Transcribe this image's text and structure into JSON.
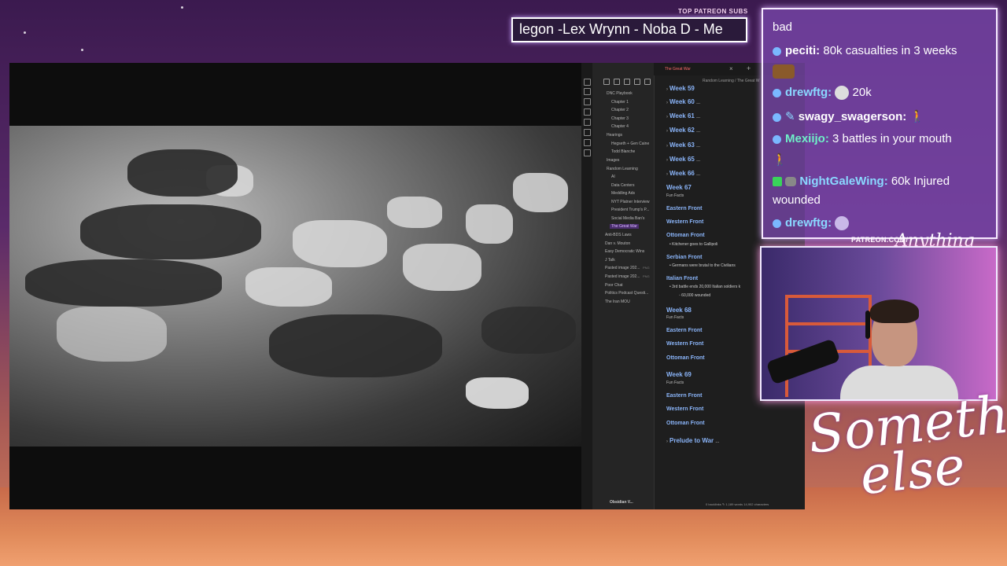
{
  "patreon": {
    "title": "TOP PATREON SUBS",
    "ticker": "legon -Lex Wrynn -  Noba D - Me"
  },
  "obsidian": {
    "tab_title": "The Great War",
    "breadcrumb": "Random Learning  /  The Great W",
    "vault_name": "Obsidian V...",
    "status": "0 backlinks   ✎  1,189 words  14,902 characters",
    "tree": [
      "DNC Playbook",
      "Chapter 1",
      "Chapter 2",
      "Chapter 3",
      "Chapter 4",
      "Hearings",
      "Hegseth + Gen Caine",
      "Todd Blanche",
      "Images",
      "Random Learning",
      "AI",
      "Data Centers",
      "Meddling Ads",
      "NYT Platner Interview",
      "President Trump's P...",
      "Social Media Ban's",
      "The Great War",
      "Anti-BDS Laws",
      "Dan v. Mouton",
      "Easy Democratic Wins",
      "J Talk",
      "Pasted image 202...",
      "Pasted image 202...",
      "Poor Chat",
      "Politics Podcast Questi...",
      "The Iran MOU"
    ],
    "tree_badges": [
      "PNG",
      "PNG"
    ],
    "outline": {
      "week59": "Week 59",
      "week60": "Week 60",
      "week61": "Week 61",
      "week62": "Week 62",
      "week63": "Week 63",
      "week65": "Week 65",
      "week66": "Week 66",
      "week67": "Week 67",
      "fun_facts_1": "Fun Facts",
      "eastern_1": "Eastern Front",
      "western_1": "Western Front",
      "ottoman_1": "Ottoman Front",
      "ottoman_note": "Kitchener goes to Gallipoli",
      "serbian": "Serbian Front",
      "serbian_note": "Germans were brutal to the Civilians",
      "italian": "Italian Front",
      "italian_note": "3rd battle ends 20,000 Italian soldiers k",
      "italian_sub": "60,000 wounded",
      "week68": "Week 68",
      "fun_facts_2": "Fun Facts",
      "eastern_2": "Eastern Front",
      "western_2": "Western Front",
      "ottoman_2": "Ottoman Front",
      "week69": "Week 69",
      "fun_facts_3": "Fun Facts",
      "eastern_3": "Eastern Front",
      "western_3": "Western Front",
      "ottoman_3": "Ottoman Front",
      "prelude": "Prelude to War",
      "ellipsis": "..."
    }
  },
  "chat": {
    "messages": [
      {
        "user": "",
        "text": "bad"
      },
      {
        "user": "peciti:",
        "text": "80k casualties in 3 weeks"
      },
      {
        "user": "drewftg:",
        "text": "20k"
      },
      {
        "user": "swagy_swagerson:",
        "text": ""
      },
      {
        "user": "Mexiijo:",
        "text": "3 battles in your mouth"
      },
      {
        "user": "NightGaleWing:",
        "text": "60k Injured"
      },
      {
        "user": "",
        "text": "wounded"
      },
      {
        "user": "drewftg:",
        "text": ""
      }
    ]
  },
  "cam": {
    "url": "PATREON.COM/",
    "script": "Anything Else?"
  },
  "brand": {
    "line1": "Something",
    "line2": "else"
  }
}
